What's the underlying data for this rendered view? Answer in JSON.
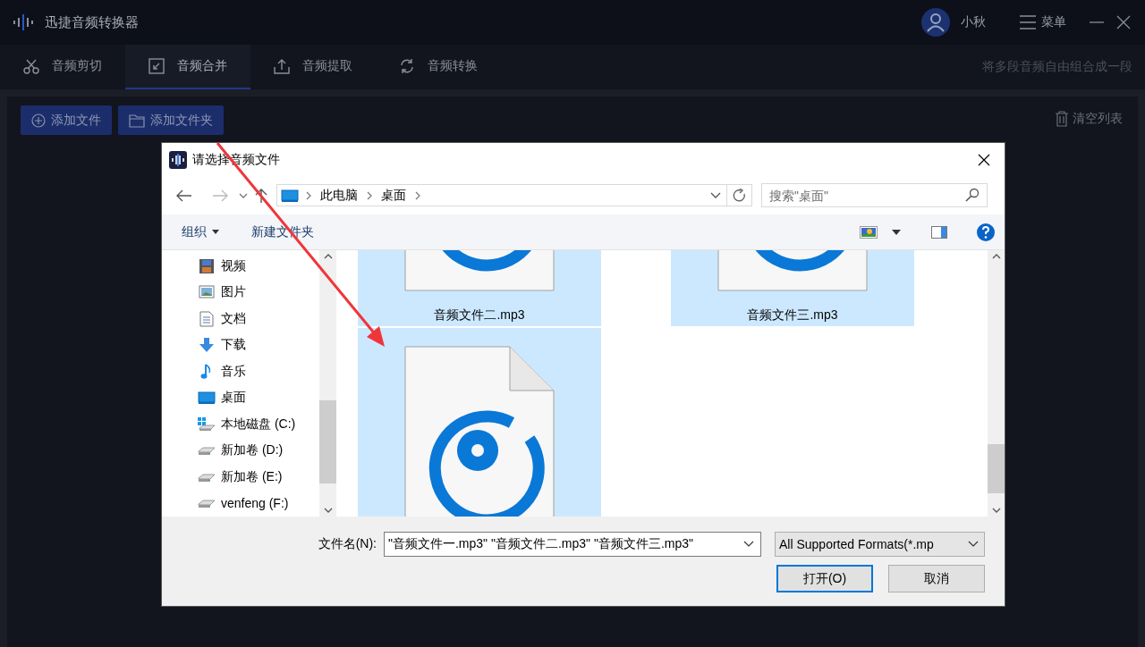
{
  "app": {
    "title": "迅捷音频转换器",
    "user": "小秋",
    "menu": "菜单"
  },
  "tabs": [
    {
      "label": "音频剪切",
      "kind": "cut",
      "selected": false
    },
    {
      "label": "音频合并",
      "kind": "merge",
      "selected": true
    },
    {
      "label": "音频提取",
      "kind": "extract",
      "selected": false
    },
    {
      "label": "音频转换",
      "kind": "convert",
      "selected": false
    }
  ],
  "tab_hint": "将多段音频自由组合成一段",
  "toolbar": {
    "buttons": [
      {
        "label": "添加文件",
        "kind": "add"
      },
      {
        "label": "添加文件夹",
        "kind": "folder"
      }
    ],
    "clear": "清空列表"
  },
  "dialog": {
    "title": "请选择音频文件",
    "path": [
      "此电脑",
      "桌面"
    ],
    "search": {
      "placeholder": "搜索\"桌面\""
    },
    "commands": [
      {
        "label": "组织",
        "kind": "menu"
      },
      {
        "label": "新建文件夹",
        "kind": "plain"
      }
    ],
    "nav": [
      {
        "label": "视频",
        "kind": "video"
      },
      {
        "label": "图片",
        "kind": "pictures"
      },
      {
        "label": "文档",
        "kind": "documents"
      },
      {
        "label": "下载",
        "kind": "downloads"
      },
      {
        "label": "音乐",
        "kind": "music"
      },
      {
        "label": "桌面",
        "kind": "desktop"
      },
      {
        "label": "本地磁盘 (C:)",
        "kind": "system-drive"
      },
      {
        "label": "新加卷 (D:)",
        "kind": "drive"
      },
      {
        "label": "新加卷 (E:)",
        "kind": "drive"
      },
      {
        "label": "venfeng (F:)",
        "kind": "drive"
      }
    ],
    "files": [
      {
        "name": "音频文件二.mp3",
        "selected": true
      },
      {
        "name": "音频文件三.mp3",
        "selected": true
      },
      {
        "selected": true
      }
    ],
    "filename_label": "文件名(N):",
    "filename": "\"音频文件一.mp3\" \"音频文件二.mp3\" \"音频文件三.mp3\"",
    "filter": "All Supported Formats(*.mp",
    "buttons": [
      {
        "label": "打开(O)",
        "default": true
      },
      {
        "label": "取消",
        "default": false
      }
    ]
  }
}
